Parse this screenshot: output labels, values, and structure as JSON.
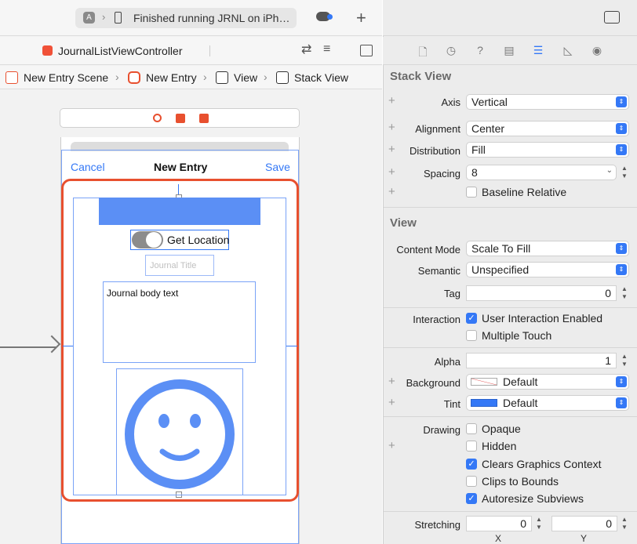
{
  "toolbar": {
    "status": "Finished running JRNL on iPh…",
    "file_tab": "JournalListViewController"
  },
  "jumpbar": {
    "items": [
      "New Entry Scene",
      "New Entry",
      "View",
      "Stack View"
    ]
  },
  "scene": {
    "nav_cancel": "Cancel",
    "nav_title": "New Entry",
    "nav_save": "Save",
    "get_location": "Get Location",
    "journal_title_placeholder": "Journal Title",
    "body_text": "Journal body text"
  },
  "inspector": {
    "stack_view": {
      "title": "Stack View",
      "axis_label": "Axis",
      "axis_value": "Vertical",
      "alignment_label": "Alignment",
      "alignment_value": "Center",
      "distribution_label": "Distribution",
      "distribution_value": "Fill",
      "spacing_label": "Spacing",
      "spacing_value": "8",
      "baseline_relative": "Baseline Relative"
    },
    "view": {
      "title": "View",
      "content_mode_label": "Content Mode",
      "content_mode_value": "Scale To Fill",
      "semantic_label": "Semantic",
      "semantic_value": "Unspecified",
      "tag_label": "Tag",
      "tag_value": "0",
      "interaction_label": "Interaction",
      "user_interaction": "User Interaction Enabled",
      "multiple_touch": "Multiple Touch",
      "alpha_label": "Alpha",
      "alpha_value": "1",
      "background_label": "Background",
      "background_value": "Default",
      "tint_label": "Tint",
      "tint_value": "Default",
      "drawing_label": "Drawing",
      "opaque": "Opaque",
      "hidden": "Hidden",
      "clears_graphics": "Clears Graphics Context",
      "clips_to_bounds": "Clips to Bounds",
      "autoresize": "Autoresize Subviews",
      "stretching_label": "Stretching",
      "stretch_x": "0",
      "stretch_y": "0",
      "x_label": "X",
      "y_label": "Y"
    }
  },
  "colors": {
    "accent": "#3478f6",
    "selection": "#e8502f",
    "placeholder": "#5b8ff5"
  }
}
